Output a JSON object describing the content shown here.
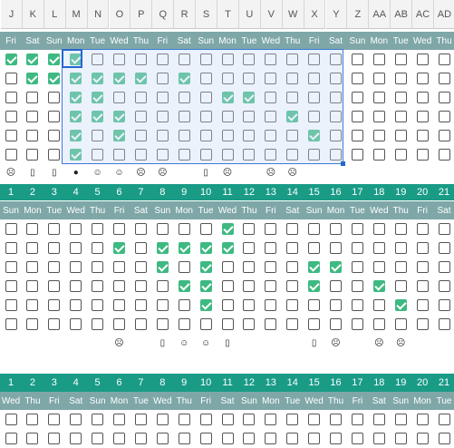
{
  "columns": [
    "J",
    "K",
    "L",
    "M",
    "N",
    "O",
    "P",
    "Q",
    "R",
    "S",
    "T",
    "U",
    "V",
    "W",
    "X",
    "Y",
    "Z",
    "AA",
    "AB",
    "AC",
    "AD"
  ],
  "colors": {
    "accent_teal": "#199b86",
    "day_band": "#7fa7a8",
    "check_green": "#3fb982",
    "selection_blue": "#3e79d8"
  },
  "block1": {
    "days": [
      "Fri",
      "Sat",
      "Sun",
      "Mon",
      "Tue",
      "Wed",
      "Thu",
      "",
      "Fri",
      "Sat",
      "Sun",
      "Mon",
      "Tue",
      "Wed",
      "Thu",
      "Fri",
      "Sat",
      "Sun",
      "Mon",
      "Tue",
      "Wed",
      "Thu"
    ],
    "checks": [
      [
        1,
        1,
        1,
        1,
        0,
        0,
        0,
        0,
        0,
        0,
        0,
        0,
        0,
        0,
        0,
        0,
        0,
        0,
        0,
        0,
        0
      ],
      [
        0,
        1,
        1,
        1,
        1,
        1,
        1,
        0,
        1,
        0,
        0,
        0,
        0,
        0,
        0,
        0,
        0,
        0,
        0,
        0,
        0
      ],
      [
        0,
        0,
        0,
        1,
        1,
        0,
        0,
        0,
        0,
        0,
        1,
        1,
        0,
        0,
        0,
        0,
        0,
        0,
        0,
        0,
        0
      ],
      [
        0,
        0,
        0,
        1,
        1,
        1,
        0,
        0,
        0,
        0,
        0,
        0,
        0,
        1,
        0,
        0,
        0,
        0,
        0,
        0,
        0
      ],
      [
        0,
        0,
        0,
        1,
        0,
        1,
        0,
        0,
        0,
        0,
        0,
        0,
        0,
        0,
        1,
        0,
        0,
        0,
        0,
        0,
        0
      ],
      [
        0,
        0,
        0,
        1,
        0,
        0,
        0,
        0,
        0,
        0,
        0,
        0,
        0,
        0,
        0,
        0,
        0,
        0,
        0,
        0,
        0
      ]
    ],
    "emoji_row": [
      "☹",
      "▯",
      "▯",
      "●",
      "☺",
      "☺",
      "☹",
      "",
      "☹",
      "",
      "▯",
      "☹",
      "",
      "☹",
      "☹",
      "",
      "",
      "",
      "",
      "",
      ""
    ]
  },
  "block2": {
    "numbers": [
      "1",
      "2",
      "3",
      "4",
      "5",
      "6",
      "7",
      "8",
      "9",
      "10",
      "11",
      "12",
      "13",
      "14",
      "15",
      "16",
      "17",
      "18",
      "19",
      "20",
      "21"
    ],
    "days": [
      "Sun",
      "Mon",
      "Tue",
      "Wed",
      "Thu",
      "Fri",
      "Sat",
      "Sun",
      "Mon",
      "Tue",
      "Wed",
      "Thu",
      "Fri",
      "Sat",
      "Sun",
      "Mon",
      "Tue",
      "Wed",
      "Thu",
      "Fri",
      "Sat"
    ],
    "checks": [
      [
        0,
        0,
        0,
        0,
        0,
        0,
        0,
        0,
        0,
        0,
        1,
        0,
        0,
        0,
        0,
        0,
        0,
        0,
        0,
        0,
        0
      ],
      [
        0,
        0,
        0,
        0,
        0,
        1,
        0,
        1,
        1,
        1,
        1,
        0,
        0,
        0,
        0,
        0,
        0,
        0,
        0,
        0,
        0
      ],
      [
        0,
        0,
        0,
        0,
        0,
        0,
        0,
        1,
        0,
        1,
        0,
        0,
        0,
        0,
        1,
        1,
        0,
        0,
        0,
        0,
        0
      ],
      [
        0,
        0,
        0,
        0,
        0,
        0,
        0,
        0,
        1,
        1,
        0,
        0,
        0,
        0,
        1,
        0,
        0,
        1,
        0,
        0,
        0
      ],
      [
        0,
        0,
        0,
        0,
        0,
        0,
        0,
        0,
        0,
        1,
        0,
        0,
        0,
        0,
        0,
        0,
        0,
        0,
        1,
        0,
        0
      ],
      [
        0,
        0,
        0,
        0,
        0,
        0,
        0,
        0,
        0,
        0,
        0,
        0,
        0,
        0,
        0,
        0,
        0,
        0,
        0,
        0,
        0
      ]
    ],
    "emoji_row": [
      "",
      "",
      "",
      "",
      "",
      "☹",
      "",
      "▯",
      "☺",
      "☺",
      "▯",
      "",
      "",
      "",
      "▯",
      "☹",
      "",
      "☹",
      "☹",
      "",
      ""
    ]
  },
  "block3": {
    "numbers": [
      "1",
      "2",
      "3",
      "4",
      "5",
      "6",
      "7",
      "8",
      "9",
      "10",
      "11",
      "12",
      "13",
      "14",
      "15",
      "16",
      "17",
      "18",
      "19",
      "20",
      "21"
    ],
    "days": [
      "Wed",
      "Thu",
      "Fri",
      "Sat",
      "Sun",
      "Mon",
      "Tue",
      "Wed",
      "Thu",
      "Fri",
      "Sat",
      "Sun",
      "Mon",
      "Tue",
      "Wed",
      "Thu",
      "Fri",
      "Sat",
      "Sun",
      "Mon",
      "Tue"
    ],
    "checks": [
      [
        0,
        0,
        0,
        0,
        0,
        0,
        0,
        0,
        0,
        0,
        0,
        0,
        0,
        0,
        0,
        0,
        0,
        0,
        0,
        0,
        0
      ],
      [
        0,
        0,
        0,
        0,
        0,
        0,
        0,
        0,
        0,
        0,
        0,
        0,
        0,
        0,
        0,
        0,
        0,
        0,
        0,
        0,
        0
      ]
    ]
  }
}
